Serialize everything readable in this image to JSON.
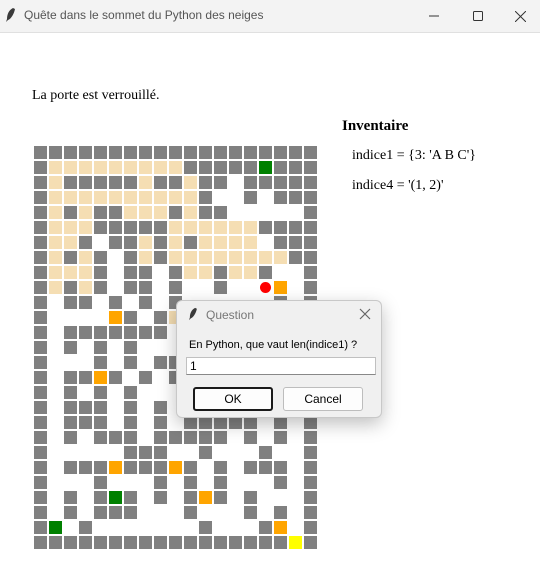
{
  "window": {
    "title": "Quête dans le sommet du Python des neiges",
    "icons": [
      "python-feather-icon",
      "minimize-icon",
      "maximize-icon",
      "close-icon"
    ]
  },
  "status_text": "La porte est verrouillé.",
  "inventory": {
    "title": "Inventaire",
    "items": [
      "indice1 = {3: 'A B C'}",
      "indice4 = '(1, 2)'"
    ]
  },
  "maze": {
    "legend": {
      "wall": "#808080",
      "floor": "#ffffff",
      "visited": "#f5deb3",
      "key": "#ffa500",
      "door": "#008000",
      "exit": "#ffff00",
      "player": "#ff0000"
    }
  },
  "dialog": {
    "title": "Question",
    "prompt": "En Python, que vaut len(indice1) ?",
    "input_value": "1",
    "ok_label": "OK",
    "cancel_label": "Cancel"
  }
}
